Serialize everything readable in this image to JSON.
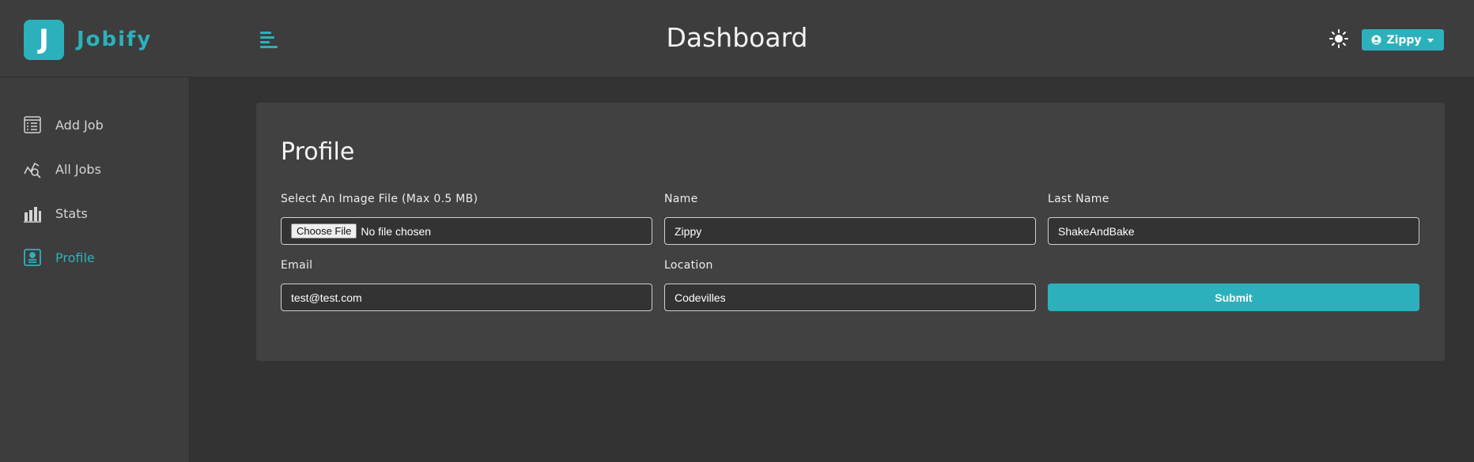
{
  "brand": {
    "logo_letter": "J",
    "name": "Jobify",
    "accent_color": "#2cb1bc"
  },
  "header": {
    "title": "Dashboard",
    "menu_icon": "hamburger-icon",
    "theme_icon": "sun-icon",
    "user_menu": {
      "label": "Zippy",
      "icon": "user-circle-icon",
      "caret_icon": "caret-down-icon"
    }
  },
  "sidebar": {
    "items": [
      {
        "label": "Add Job",
        "icon": "add-job-icon",
        "active": false
      },
      {
        "label": "All Jobs",
        "icon": "all-jobs-icon",
        "active": false
      },
      {
        "label": "Stats",
        "icon": "stats-icon",
        "active": false
      },
      {
        "label": "Profile",
        "icon": "profile-icon",
        "active": true
      }
    ]
  },
  "profile_form": {
    "title": "Profile",
    "image": {
      "label": "Select An Image File (Max 0.5 MB)",
      "button": "Choose File",
      "status": "No file chosen"
    },
    "name": {
      "label": "Name",
      "value": "Zippy"
    },
    "last_name": {
      "label": "Last Name",
      "value": "ShakeAndBake"
    },
    "email": {
      "label": "Email",
      "value": "test@test.com"
    },
    "location": {
      "label": "Location",
      "value": "Codevilles"
    },
    "submit_label": "Submit"
  }
}
